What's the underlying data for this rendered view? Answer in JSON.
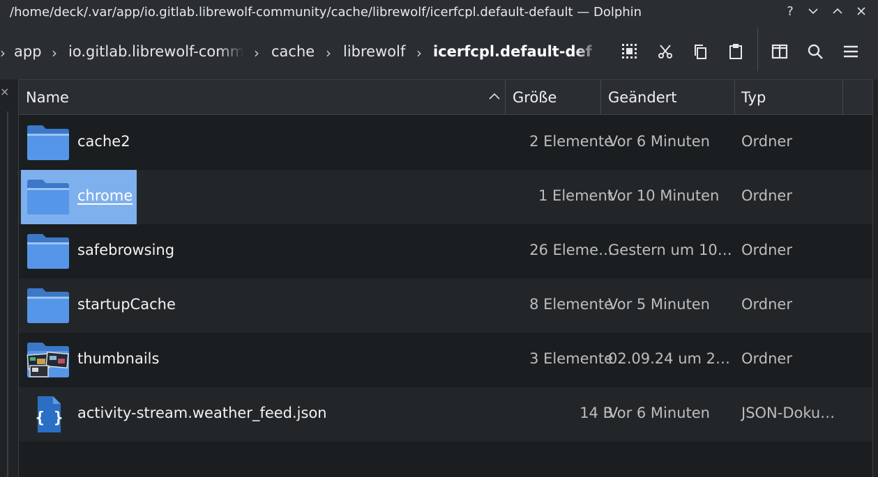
{
  "window": {
    "title": "/home/deck/.var/app/io.gitlab.librewolf-community/cache/librewolf/icerfcpl.default-default — Dolphin",
    "help_label": "?"
  },
  "breadcrumb": [
    {
      "label": "app"
    },
    {
      "label": "io.gitlab.librewolf-community"
    },
    {
      "label": "cache"
    },
    {
      "label": "librewolf"
    },
    {
      "label": "icerfcpl.default-default",
      "current": true
    }
  ],
  "toolbar": {
    "icons": [
      "select-all-icon",
      "cut-icon",
      "copy-icon",
      "paste-icon",
      "split-view-icon",
      "search-icon",
      "menu-icon"
    ]
  },
  "columns": {
    "name": "Name",
    "size": "Größe",
    "modified": "Geändert",
    "type": "Typ"
  },
  "files": [
    {
      "name": "cache2",
      "size": "2 Elemente",
      "modified": "Vor 6 Minuten",
      "type": "Ordner",
      "icon": "folder-icon"
    },
    {
      "name": "chrome",
      "size": "1 Element",
      "modified": "Vor 10 Minuten",
      "type": "Ordner",
      "icon": "folder-icon",
      "selected": true
    },
    {
      "name": "safebrowsing",
      "size": "26 Eleme…",
      "modified": "Gestern um 10…",
      "type": "Ordner",
      "icon": "folder-icon"
    },
    {
      "name": "startupCache",
      "size": "8 Elemente",
      "modified": "Vor 5 Minuten",
      "type": "Ordner",
      "icon": "folder-icon"
    },
    {
      "name": "thumbnails",
      "size": "3 Elemente",
      "modified": "02.09.24 um 2…",
      "type": "Ordner",
      "icon": "folder-thumbnails-icon"
    },
    {
      "name": "activity-stream.weather_feed.json",
      "size": "14 B",
      "modified": "Vor 6 Minuten",
      "type": "JSON-Doku…",
      "icon": "json-file-icon"
    }
  ],
  "colors": {
    "folder": "#4a8fe0",
    "selection": "#7fb0ee",
    "background": "#1b1e20"
  }
}
